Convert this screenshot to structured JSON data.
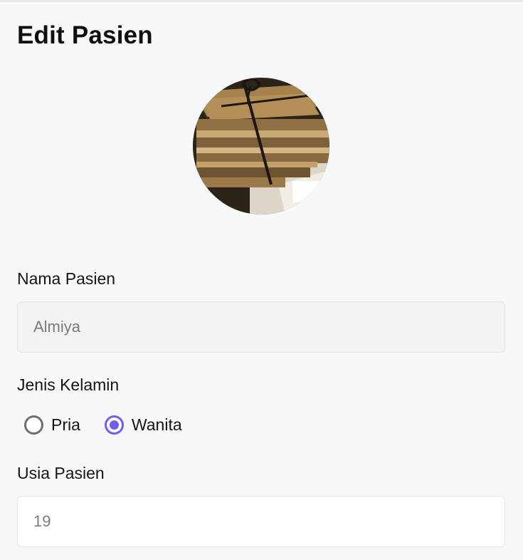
{
  "page": {
    "title": "Edit Pasien"
  },
  "avatar": {
    "icon": "patient-photo",
    "description": "patient profile photo"
  },
  "form": {
    "name": {
      "label": "Nama Pasien",
      "value": "Almiya",
      "disabled": true
    },
    "gender": {
      "label": "Jenis Kelamin",
      "options": [
        {
          "label": "Pria",
          "selected": false
        },
        {
          "label": "Wanita",
          "selected": true
        }
      ]
    },
    "age": {
      "label": "Usia Pasien",
      "value": "19"
    }
  },
  "colors": {
    "accent": "#6d5df4",
    "background": "#f7f8fa",
    "disabled_input": "#f3f3f4",
    "border": "#e3e4e7"
  }
}
